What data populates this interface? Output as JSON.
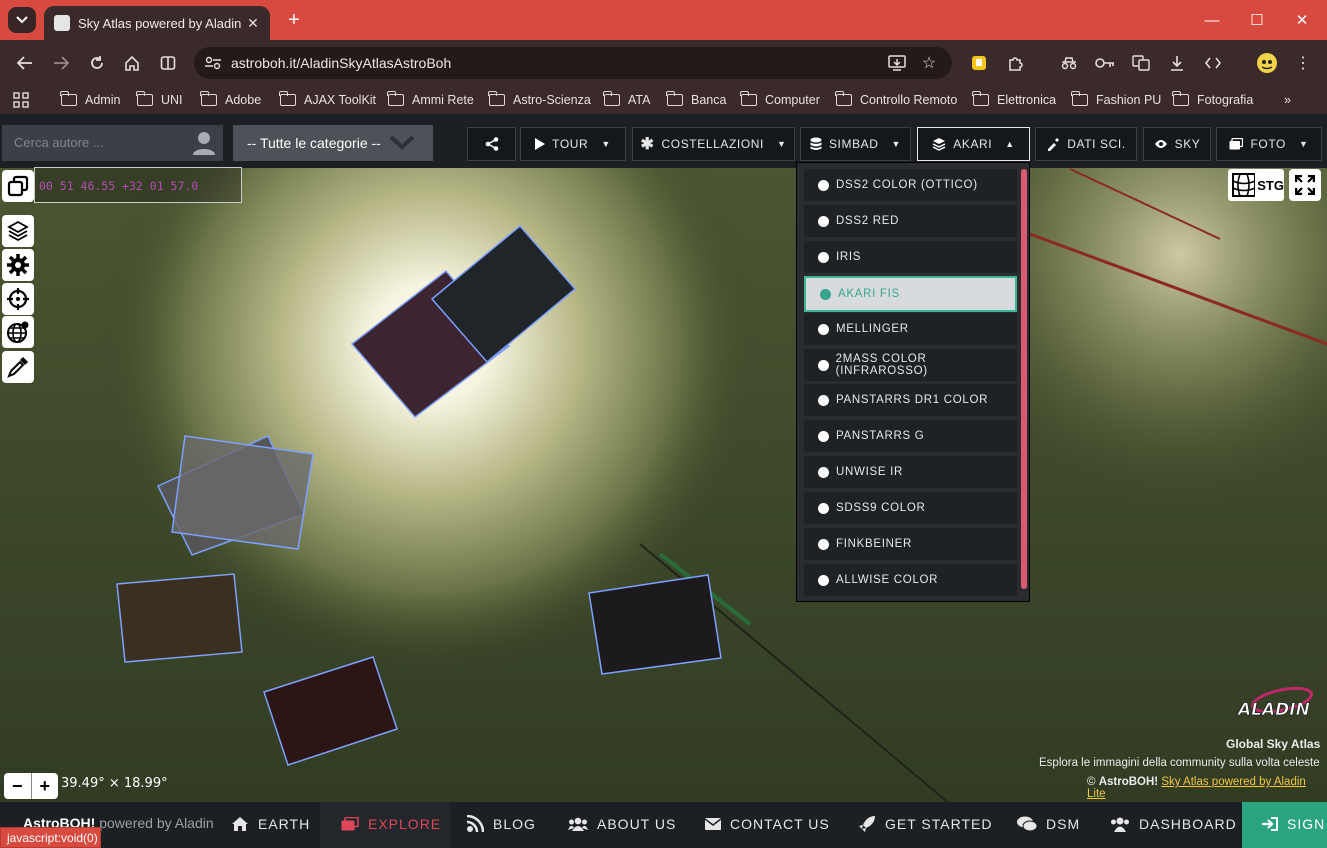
{
  "browser": {
    "tab_title": "Sky Atlas powered by Aladin Lite",
    "url": "astroboh.it/AladinSkyAtlasAstroBoh",
    "bookmarks": [
      "Admin",
      "UNI",
      "Adobe",
      "AJAX ToolKit",
      "Ammi Rete",
      "Astro-Scienza",
      "ATA",
      "Banca",
      "Computer",
      "Controllo Remoto",
      "Elettronica",
      "Fashion PU",
      "Fotografia"
    ],
    "status_text": "javascript:void(0)"
  },
  "nav": {
    "search_placeholder": "Cerca autore ...",
    "category": "-- Tutte le categorie --",
    "tour": "TOUR",
    "costellazioni": "COSTELLAZIONI",
    "simbad": "SIMBAD",
    "akari": "AKARI",
    "dati_sci": "DATI SCI.",
    "sky": "SKY",
    "foto": "FOTO"
  },
  "aladin": {
    "coordinates": "00 51 46.55 +32 01 57.0",
    "projection": "STG",
    "fov": "39.49° × 18.99°",
    "logo_text": "ALADIN"
  },
  "survey_dropdown": {
    "items": [
      "DSS2 COLOR (OTTICO)",
      "DSS2 RED",
      "IRIS",
      "AKARI FIS",
      "MELLINGER",
      "2MASS COLOR (INFRAROSSO)",
      "PANSTARRS DR1 COLOR",
      "PANSTARRS G",
      "UNWISE IR",
      "SDSS9 COLOR",
      "FINKBEINER",
      "ALLWISE COLOR"
    ],
    "selected": "AKARI FIS"
  },
  "credits": {
    "title": "Global Sky Atlas",
    "subtitle": "Esplora le immagini della community sulla volta celeste",
    "copyright_prefix": "©",
    "brand": "AstroBOH!",
    "link": "Sky Atlas powered by Aladin Lite"
  },
  "bottom": {
    "brand": "AstroBOH!",
    "brand_suffix": "powered by Aladin",
    "earth": "EARTH",
    "explore": "EXPLORE",
    "blog": "BLOG",
    "about": "ABOUT US",
    "contact": "CONTACT US",
    "get_started": "GET STARTED",
    "dsm": "DSM",
    "dashboard": "DASHBOARD",
    "sign": "SIGN"
  },
  "colors": {
    "accent_teal": "#3aa58d",
    "chrome_red": "#d84a3f",
    "explore_red": "#e0465a",
    "credit_link": "#f0c940"
  }
}
